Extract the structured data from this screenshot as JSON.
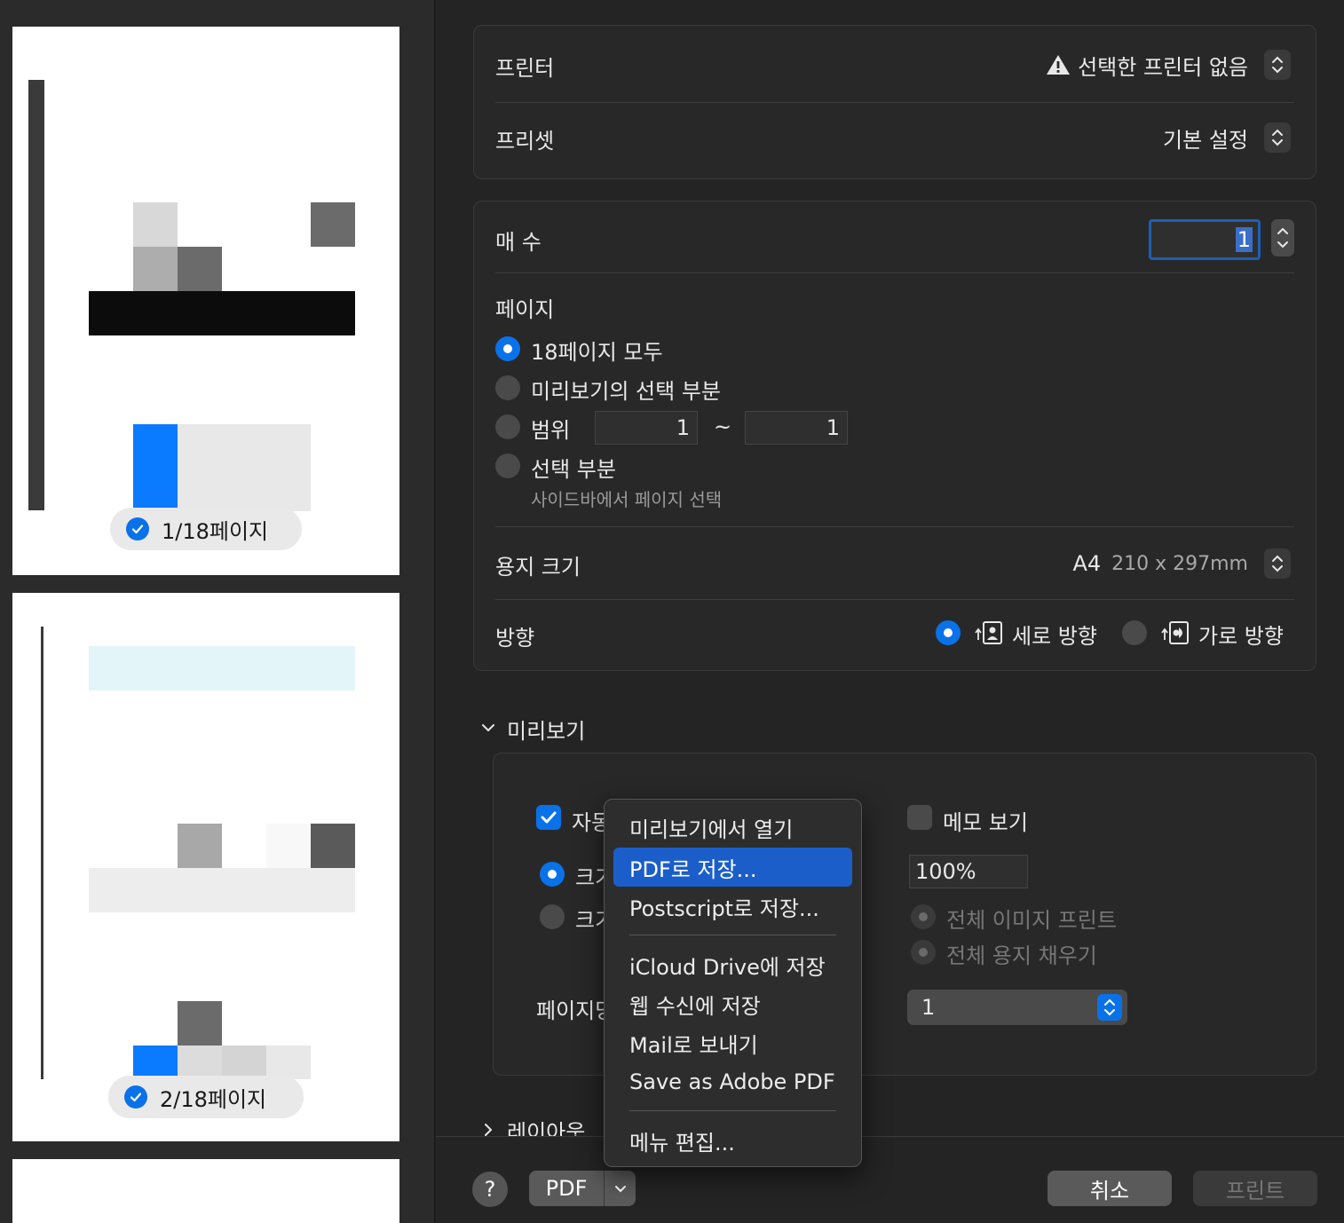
{
  "sidebar": {
    "page1_label": "1/18페이지",
    "page2_label": "2/18페이지"
  },
  "printer": {
    "label": "프린터",
    "value": "선택한 프린터 없음",
    "icon": "warning-icon"
  },
  "preset": {
    "label": "프리셋",
    "value": "기본 설정"
  },
  "copies": {
    "label": "매 수",
    "value": "1"
  },
  "pages": {
    "label": "페이지",
    "options": {
      "all": "18페이지 모두",
      "selection_preview": "미리보기의 선택 부분",
      "range": "범위",
      "selected": "선택 부분"
    },
    "range_from": "1",
    "range_tilde": "~",
    "range_to": "1",
    "selected_hint": "사이드바에서 페이지 선택"
  },
  "paper_size": {
    "label": "용지 크기",
    "value": "A4",
    "dimensions": "210 x 297mm"
  },
  "orientation": {
    "label": "방향",
    "portrait": "세로 방향",
    "landscape": "가로 방향"
  },
  "preview_section": {
    "label": "미리보기",
    "auto_rotate": "자동",
    "size_label_1": "크기",
    "size_label_2": "크기",
    "show_notes": "메모 보기",
    "scale_value": "100%",
    "print_entire_image": "전체 이미지 프린트",
    "fill_entire_paper": "전체 용지 채우기",
    "copies_per_page_label": "페이지당",
    "copies_per_page_value": "1"
  },
  "layout_section": {
    "label": "레이아웃"
  },
  "pdf_menu": {
    "items": [
      "미리보기에서 열기",
      "PDF로 저장...",
      "Postscript로 저장...",
      "iCloud Drive에 저장",
      "웹 수신에 저장",
      "Mail로 보내기",
      "Save as Adobe PDF",
      "메뉴 편집..."
    ]
  },
  "footer": {
    "help": "?",
    "pdf": "PDF",
    "cancel": "취소",
    "print": "프린트"
  }
}
